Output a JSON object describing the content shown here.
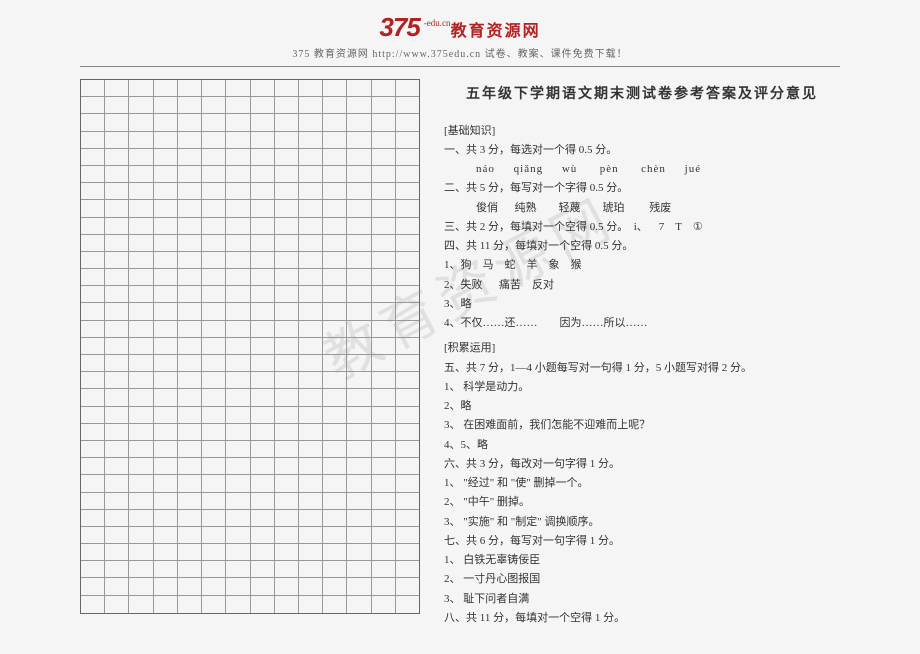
{
  "header": {
    "logo_num": "375",
    "logo_sup": "-edu.cn",
    "logo_text": "教育资源网",
    "sub": "375 教育资源网  http://www.375edu.cn 试卷、教案、课件免费下载！"
  },
  "watermark": "教育资源网",
  "doc": {
    "title": "五年级下学期语文期末测试卷参考答案及评分意见",
    "sections": [
      {
        "cls": "section-label",
        "text": "[基础知识]"
      },
      {
        "cls": "indent1",
        "text": "一、共 3 分，每选对一个得 0.5 分。"
      },
      {
        "cls": "pinyin",
        "text": "náo     qiǎng     wù      pèn      chèn     jué"
      },
      {
        "cls": "indent1",
        "text": "二、共 5 分，每写对一个字得 0.5 分。"
      },
      {
        "cls": "indent2",
        "text": "俊俏      纯熟        轻蔑        琥珀         残废"
      },
      {
        "cls": "indent1",
        "text": "三、共 2 分，每填对一个空得 0.5 分。  i、    7    T    ①"
      },
      {
        "cls": "indent1",
        "text": "四、共 11 分，每填对一个空得 0.5 分。"
      },
      {
        "cls": "indent1",
        "text": "1、狗    马    蛇    羊    象    猴"
      },
      {
        "cls": "indent1",
        "text": "2、失败      痛苦    反对"
      },
      {
        "cls": "indent1",
        "text": "3、略"
      },
      {
        "cls": "indent1",
        "text": "4、不仅……还……        因为……所以……"
      },
      {
        "cls": "section-label",
        "text": ""
      },
      {
        "cls": "section-label",
        "text": "[积累运用]"
      },
      {
        "cls": "indent1",
        "text": "五、共 7 分，1—4 小题每写对一句得 1 分，5 小题写对得 2 分。"
      },
      {
        "cls": "indent1",
        "text": "1、 科学是动力。"
      },
      {
        "cls": "indent1",
        "text": "2、略"
      },
      {
        "cls": "indent1",
        "text": "3、 在困难面前，我们怎能不迎难而上呢？"
      },
      {
        "cls": "indent1",
        "text": "4、5、略"
      },
      {
        "cls": "indent1",
        "text": "六、共 3 分，每改对一句字得 1 分。"
      },
      {
        "cls": "indent1",
        "text": "1、 \"经过\" 和 \"使\" 删掉一个。"
      },
      {
        "cls": "indent1",
        "text": "2、 \"中午\" 删掉。"
      },
      {
        "cls": "indent1",
        "text": "3、 \"实施\" 和 \"制定\" 调换顺序。"
      },
      {
        "cls": "indent1",
        "text": "七、共 6 分，每写对一句字得 1 分。"
      },
      {
        "cls": "indent1",
        "text": "1、 白铁无辜铸佞臣"
      },
      {
        "cls": "indent1",
        "text": "2、 一寸丹心图报国"
      },
      {
        "cls": "indent1",
        "text": "3、 耻下问者自满"
      },
      {
        "cls": "indent1",
        "text": "八、共 11 分，每填对一个空得 1 分。"
      }
    ]
  },
  "grid": {
    "rows": 31,
    "cols": 14
  }
}
